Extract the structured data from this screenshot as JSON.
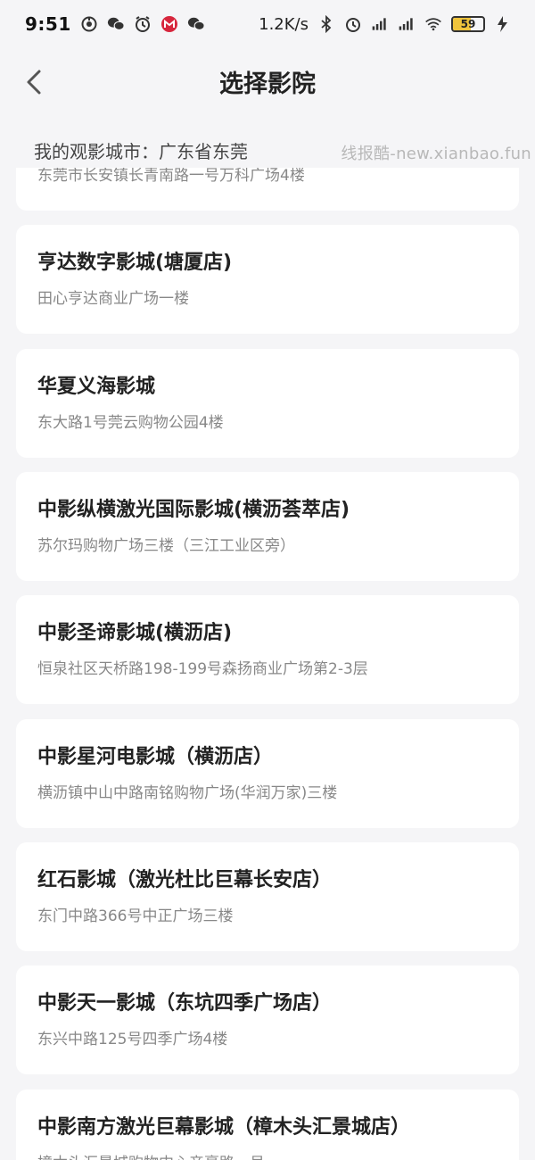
{
  "status_bar": {
    "time": "9:51",
    "net_speed": "1.2K/s",
    "battery": "59",
    "battery_level": 0.59,
    "icons": [
      "hotspot-icon",
      "wechat-icon",
      "alarm-icon",
      "metro-icon",
      "wechat-icon"
    ]
  },
  "nav": {
    "title": "选择影院"
  },
  "city": {
    "label": "我的观影城市：广东省东莞"
  },
  "watermark": "线报酷-new.xianbao.fun",
  "cinemas": [
    {
      "name": "",
      "address": "东莞市长安镇长青南路一号万科广场4楼"
    },
    {
      "name": "亨达数字影城(塘厦店)",
      "address": "田心亨达商业广场一楼"
    },
    {
      "name": "华夏义海影城",
      "address": "东大路1号莞云购物公园4楼"
    },
    {
      "name": "中影纵横激光国际影城(横沥荟萃店)",
      "address": "苏尔玛购物广场三楼（三江工业区旁）"
    },
    {
      "name": "中影圣谛影城(横沥店)",
      "address": "恒泉社区天桥路198-199号森扬商业广场第2-3层"
    },
    {
      "name": "中影星河电影城（横沥店）",
      "address": "横沥镇中山中路南铭购物广场(华润万家)三楼"
    },
    {
      "name": "红石影城（激光杜比巨幕长安店）",
      "address": "东门中路366号中正广场三楼"
    },
    {
      "name": "中影天一影城（东坑四季广场店）",
      "address": "东兴中路125号四季广场4楼"
    },
    {
      "name": "中影南方激光巨幕影城（樟木头汇景城店）",
      "address": "樟木头汇景城购物中心帝豪路一号"
    }
  ]
}
